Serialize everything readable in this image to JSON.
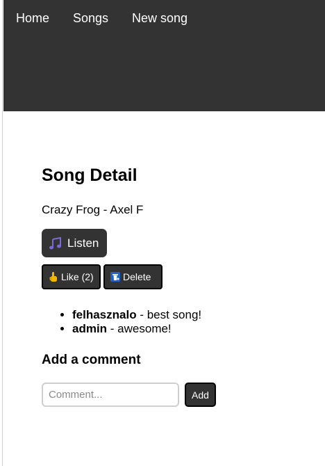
{
  "nav": {
    "items": [
      {
        "label": "Home"
      },
      {
        "label": "Songs"
      },
      {
        "label": "New song"
      }
    ]
  },
  "page": {
    "title": "Song Detail",
    "song": "Crazy Frog - Axel F"
  },
  "actions": {
    "listen_label": "Listen",
    "listen_icon": "musical-note-icon",
    "like_label": "Like (2)",
    "like_icon": "pointing-hand-icon",
    "delete_label": "Delete",
    "delete_icon": "trash-icon"
  },
  "comments": [
    {
      "user": "felhasznalo",
      "separator": " - ",
      "text": "best song!"
    },
    {
      "user": "admin",
      "separator": " - ",
      "text": "awesome!"
    }
  ],
  "add_comment": {
    "title": "Add a comment",
    "placeholder": "Comment...",
    "value": "",
    "button_label": "Add"
  },
  "colors": {
    "navbar_bg": "#333333",
    "button_bg": "#333333",
    "button_text": "#ffffff",
    "note_icon": "#7b68d9",
    "delete_icon_bg": "#1e63c8"
  }
}
